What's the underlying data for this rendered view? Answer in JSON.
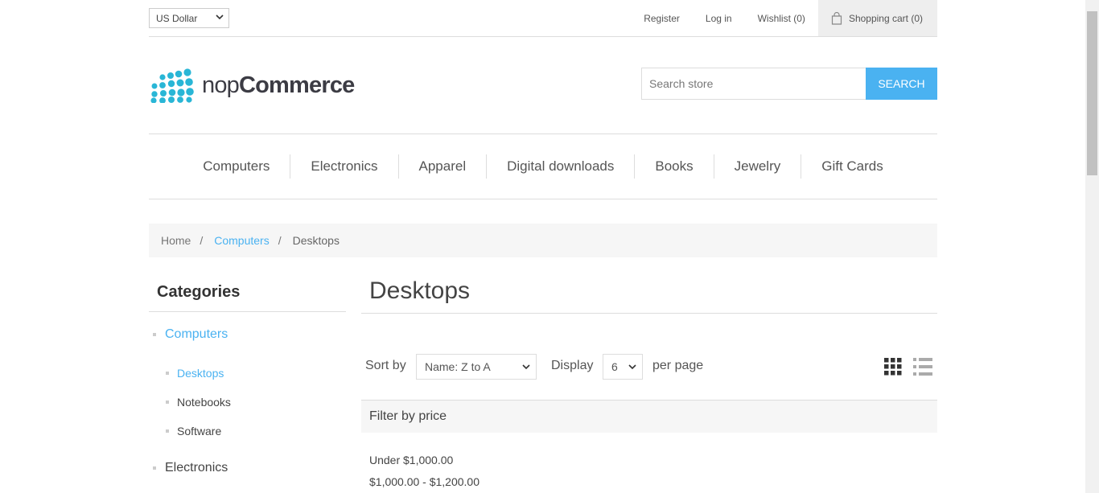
{
  "header": {
    "currency": "US Dollar",
    "links": {
      "register": "Register",
      "login": "Log in",
      "wishlist": "Wishlist (0)",
      "cart": "Shopping cart (0)"
    },
    "logo": {
      "light": "nop",
      "bold": "Commerce"
    },
    "search": {
      "placeholder": "Search store",
      "button": "SEARCH"
    }
  },
  "menu": [
    "Computers",
    "Electronics",
    "Apparel",
    "Digital downloads",
    "Books",
    "Jewelry",
    "Gift Cards"
  ],
  "breadcrumb": {
    "home": "Home",
    "sep": "/",
    "parent": "Computers",
    "current": "Desktops"
  },
  "sidebar": {
    "title": "Categories",
    "categories": [
      {
        "label": "Computers",
        "active": true
      },
      {
        "label": "Electronics",
        "active": false
      }
    ],
    "subcategories": [
      {
        "label": "Desktops",
        "active": true
      },
      {
        "label": "Notebooks",
        "active": false
      },
      {
        "label": "Software",
        "active": false
      }
    ]
  },
  "main": {
    "title": "Desktops",
    "sort_label": "Sort by",
    "sort_value": "Name: Z to A",
    "display_label": "Display",
    "display_value": "6",
    "per_page_label": "per page",
    "filter_title": "Filter by price",
    "price_ranges": [
      "Under $1,000.00",
      "$1,000.00 - $1,200.00"
    ]
  },
  "colors": {
    "accent": "#4ab2f1",
    "logo": "#29b6d6"
  }
}
